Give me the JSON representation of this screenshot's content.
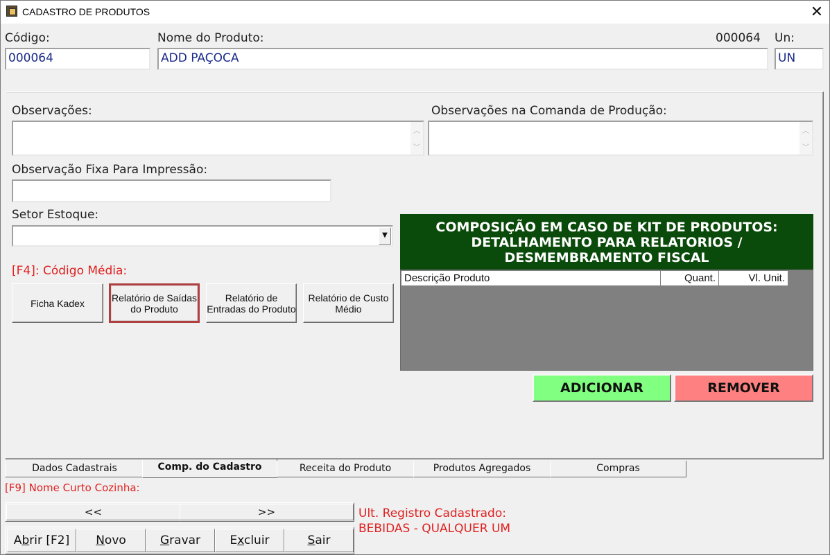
{
  "window": {
    "title": "CADASTRO DE PRODUTOS",
    "close_glyph": "✕"
  },
  "header": {
    "codigo_label": "Código:",
    "codigo_value": "000064",
    "nome_label": "Nome do Produto:",
    "nome_value": "ADD PAÇOCA",
    "code_display": "000064",
    "un_label": "Un:",
    "un_value": "UN"
  },
  "comp": {
    "obs_label": "Observações:",
    "obs_comanda_label": "Observações na Comanda de Produção:",
    "obs_fixa_label": "Observação Fixa Para Impressão:",
    "setor_label": "Setor Estoque:",
    "f4_label": "[F4]: Código Média:",
    "buttons": {
      "ficha_kadex": "Ficha Kadex",
      "rel_saidas": "Relatório de Saídas do Produto",
      "rel_entradas": "Relatório de Entradas do Produto",
      "rel_custo": "Relatório de Custo Médio"
    }
  },
  "kit": {
    "header_lines": [
      "COMPOSIÇÃO EM CASO DE KIT DE PRODUTOS:",
      "DETALHAMENTO PARA RELATORIOS /",
      "DESMEMBRAMENTO FISCAL"
    ],
    "columns": [
      "Descrição Produto",
      "Quant.",
      "Vl. Unit."
    ],
    "add_label": "ADICIONAR",
    "remove_label": "REMOVER",
    "add_color": "#80ff80",
    "remove_color": "#ff8080"
  },
  "tabs": [
    "Dados Cadastrais",
    "Comp. do Cadastro",
    "Receita do Produto",
    "Produtos Agregados",
    "Compras"
  ],
  "active_tab": "Comp. do Cadastro",
  "footer": {
    "f9_label": "[F9] Nome Curto Cozinha:",
    "prev_label": "<<",
    "next_label": ">>",
    "ult_registro_label": "Ult. Registro Cadastrado:",
    "ult_registro_value": "BEBIDAS - QUALQUER UM",
    "actions": {
      "abrir": {
        "pre": "A",
        "key": "b",
        "post": "rir [F2]"
      },
      "novo": {
        "pre": "",
        "key": "N",
        "post": "ovo"
      },
      "gravar": {
        "pre": "",
        "key": "G",
        "post": "ravar"
      },
      "excluir": {
        "pre": "E",
        "key": "x",
        "post": "cluir"
      },
      "sair": {
        "pre": "",
        "key": "S",
        "post": "air"
      }
    }
  },
  "colors": {
    "kit_header_bg": "#0a4a0a",
    "label_red": "#e02020",
    "field_text": "#1a2a8a"
  }
}
